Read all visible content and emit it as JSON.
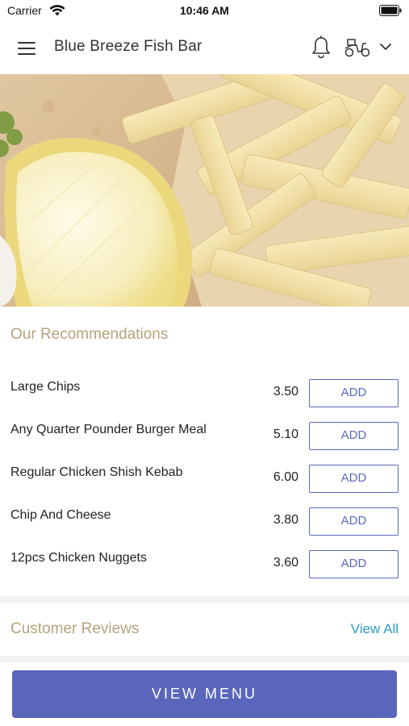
{
  "status_bar": {
    "carrier": "Carrier",
    "time": "10:46 AM",
    "wifi_icon": "wifi-icon",
    "battery_icon": "battery-icon"
  },
  "header": {
    "title": "Blue Breeze Fish Bar",
    "menu_icon": "hamburger-menu-icon",
    "notification_icon": "bell-icon",
    "delivery_icon": "scooter-icon",
    "dropdown_icon": "chevron-down-icon"
  },
  "hero": {
    "image": "fish-and-chips-with-lemon-photo"
  },
  "recommendations": {
    "title": "Our Recommendations",
    "items": [
      {
        "name": "Large Chips",
        "price": "3.50",
        "button": "ADD"
      },
      {
        "name": "Any Quarter Pounder Burger Meal",
        "price": "5.10",
        "button": "ADD"
      },
      {
        "name": "Regular Chicken Shish Kebab",
        "price": "6.00",
        "button": "ADD"
      },
      {
        "name": "Chip And Cheese",
        "price": "3.80",
        "button": "ADD"
      },
      {
        "name": "12pcs Chicken Nuggets",
        "price": "3.60",
        "button": "ADD"
      }
    ]
  },
  "reviews": {
    "title": "Customer Reviews",
    "view_all": "View All"
  },
  "footer": {
    "view_menu": "VIEW MENU"
  },
  "colors": {
    "accent": "#5a66bb",
    "section_title": "#b7a37c",
    "link": "#2f9ec5",
    "divider": "#f1f1f1"
  }
}
